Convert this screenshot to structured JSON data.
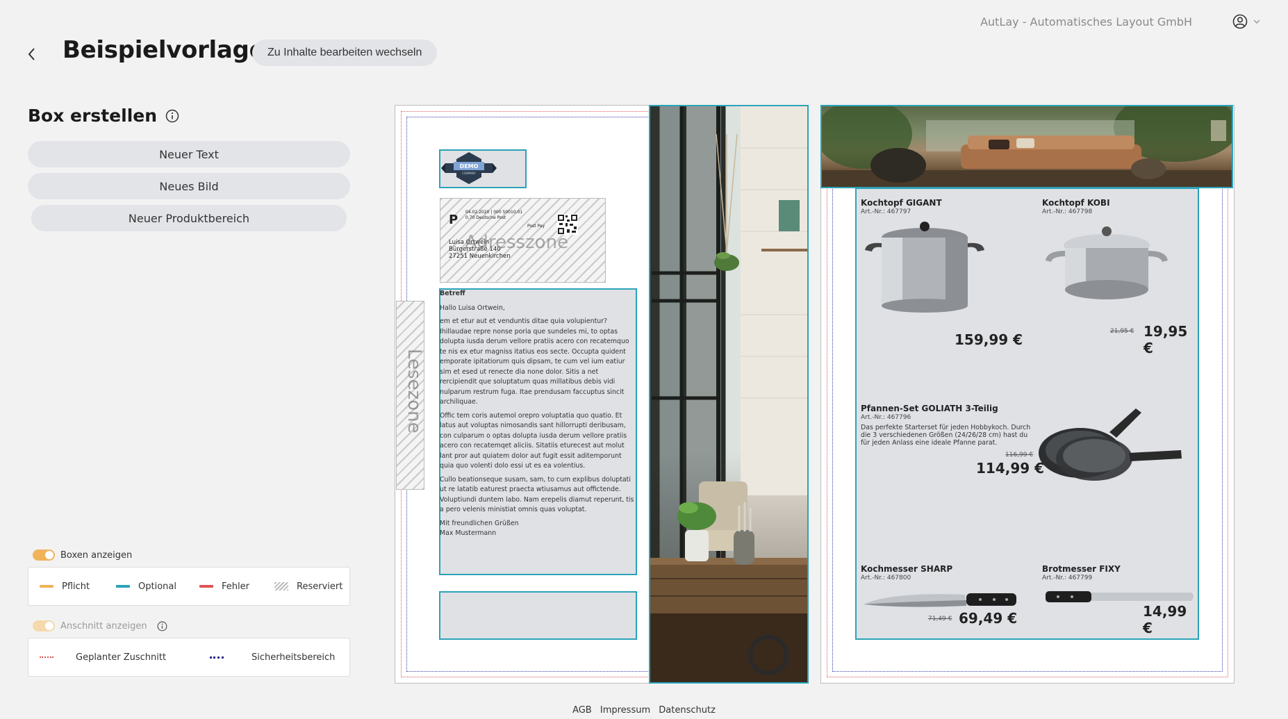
{
  "header": {
    "title": "Beispielvorlage",
    "switch_button": "Zu Inhalte bearbeiten wechseln",
    "company": "AutLay - Automatisches Layout GmbH"
  },
  "sidebar": {
    "heading": "Box erstellen",
    "buttons": {
      "new_text": "Neuer Text",
      "new_image": "Neues Bild",
      "new_product_area": "Neuer Produktbereich"
    },
    "show_boxes_label": "Boxen anzeigen",
    "box_legend": {
      "required": "Pflicht",
      "optional": "Optional",
      "error": "Fehler",
      "reserved": "Reserviert"
    },
    "show_bleed_label": "Anschnitt anzeigen",
    "bleed_legend": {
      "planned_cut": "Geplanter Zuschnitt",
      "safety_area": "Sicherheitsbereich"
    },
    "colors": {
      "required": "#f0b35a",
      "optional": "#2ba3b8",
      "error": "#e05555"
    }
  },
  "canvas": {
    "address_zone": "Adresszone",
    "reading_zone": "Lesezone",
    "logo": {
      "line1": "DEMO",
      "line2": "COMPANY"
    },
    "stamp": {
      "sender_line": "04.02.2020 | 000 50010.01",
      "postage": "0,70 Deutsche Post",
      "service": "Post Pay",
      "name": "Luisa Ortwein",
      "street": "Bürgerstraße 140",
      "city": "27251 Neuenkirchen"
    },
    "letter": {
      "subject": "Betreff",
      "greeting": "Hallo Luisa Ortwein,",
      "p1": "em et etur aut et venduntis ditae quia volupientur? Ihillaudae repre nonse poria que sundeles mi, to optas dolupta iusda derum vellore pratiis acero con recatemquo te nis ex etur magniss itatius eos secte. Occupta quident emporate ipitatiorum quis dipsam, te cum vel ium eatiur sim et esed ut renecte dia none dolor. Sitis a net rercipiendit que soluptatum quas millatibus debis vidi nulparum restrum fuga. Itae prendusam faccuptus sincit archiliquae.",
      "p2": "Offic tem coris autemol orepro voluptatia quo quatio. Et latus aut voluptas nimosandis sant hillorrupti deribusam, con culparum o optas dolupta iusda derum vellore pratiis acero con recatemqet aliciis. Sitatiis eturecest aut molut lant pror aut quiatem dolor aut fugit essit aditemporunt quia quo volenti dolo essi ut es ea volentius.",
      "p3": "Cullo beationseque susam, sam, to cum explibus doluptati ut re latatib eaturest praecta wtiusamus aut offictende. Voluptiundi duntem labo. Nam erepelis diamut reperunt, tis a pero velenis ministiat omnis quas voluptat.",
      "closing": "Mit freundlichen Grüßen",
      "signature": "Max Mustermann"
    },
    "products": [
      {
        "name": "Kochtopf GIGANT",
        "art": "Art.-Nr.: 467797",
        "price": "159,99 €",
        "old_price": ""
      },
      {
        "name": "Kochtopf KOBI",
        "art": "Art.-Nr.: 467798",
        "price": "19,95 €",
        "old_price": "21,95 €"
      },
      {
        "name": "Pfannen-Set GOLIATH 3-Teilig",
        "art": "Art.-Nr.: 467796",
        "desc": "Das perfekte Starterset für jeden Hobbykoch. Durch die 3 verschiedenen Größen (24/26/28 cm) hast du für jeden Anlass eine ideale Pfanne parat.",
        "price": "114,99 €",
        "old_price": "116,99 €"
      },
      {
        "name": "Kochmesser SHARP",
        "art": "Art.-Nr.: 467800",
        "price": "69,49 €",
        "old_price": "71,49 €"
      },
      {
        "name": "Brotmesser FIXY",
        "art": "Art.-Nr.: 467799",
        "price": "14,99 €",
        "old_price": ""
      }
    ]
  },
  "footer": {
    "agb": "AGB",
    "impressum": "Impressum",
    "datenschutz": "Datenschutz"
  }
}
